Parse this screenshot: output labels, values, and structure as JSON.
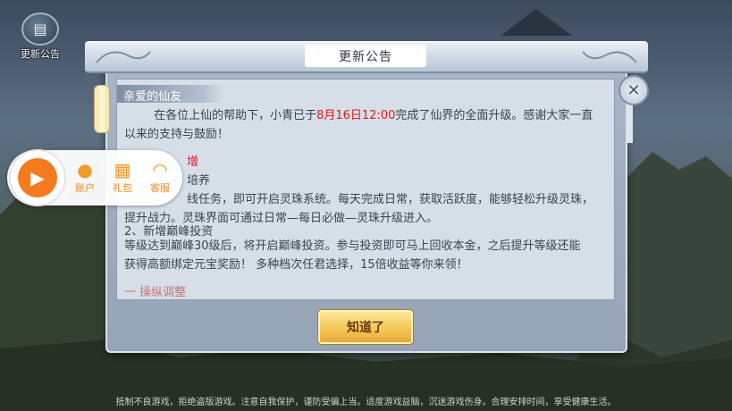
{
  "top_left": {
    "label": "更新公告",
    "icon": "scroll-icon"
  },
  "dialog": {
    "title": "更新公告",
    "greeting": "亲爱的仙友",
    "intro_prefix": "在各位上仙的帮助下，小青已于",
    "intro_date": "8月16日12:00",
    "intro_suffix": "完成了仙界的全面升级。感谢大家一直",
    "intro_line2": "以来的支持与鼓励！",
    "section_head": "增",
    "item1_title": "培养",
    "item1_line1": "线任务，即可开启灵珠系统。每天完成日常，获取活跃度，能够轻松升级灵珠，",
    "item1_line2": "提升战力。灵珠界面可通过日常—每日必做—灵珠升级进入。",
    "item2_title": "2、新增巅峰投资",
    "item2_line1": "等级达到巅峰30级后，将开启巅峰投资。参与投资即可马上回收本金，之后提升等级还能",
    "item2_line2": "获得高额绑定元宝奖励！ 多种档次任君选择，15倍收益等你来领！",
    "item3_partial": "一 操纵调整",
    "confirm_button": "知道了",
    "close_icon": "close-icon"
  },
  "float_menu": {
    "main_icon": "play-orb-icon",
    "items": [
      {
        "label": "账户",
        "icon": "user-icon"
      },
      {
        "label": "礼包",
        "icon": "gift-icon"
      },
      {
        "label": "客服",
        "icon": "headset-icon"
      }
    ]
  },
  "footer": "抵制不良游戏，拒绝盗版游戏。注意自我保护，谨防受骗上当。适度游戏益脑，沉迷游戏伤身。合理安排时间，享受健康生活。"
}
